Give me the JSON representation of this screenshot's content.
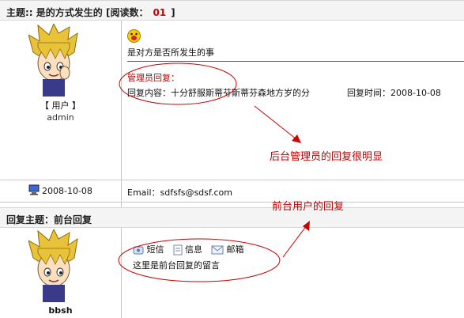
{
  "post1": {
    "title": "主题:: 是的方式发生的 [阅读数：",
    "read_count": "01",
    "title_end": "]",
    "role": "【 用户 】",
    "username": "admin",
    "body": "是对方是否所发生的事",
    "admin_reply_label": "管理员回复：",
    "reply_content": "回复内容：十分舒服斯蒂芬斯蒂芬森地方岁的分",
    "reply_time": "回复时间：2008-10-08",
    "date": "2008-10-08",
    "email": "Email：sdfsfs@sdsf.com"
  },
  "post2": {
    "title": "回复主题：前台回复",
    "buttons": [
      "短信",
      "信息",
      "邮箱"
    ],
    "body": "这里是前台回复的留言",
    "username": "bbsh"
  },
  "annotations": {
    "admin_note": "后台管理员的回复很明显",
    "front_note": "前台用户的回复"
  },
  "colors": {
    "annotation": "#cc0000",
    "header_bg": "#f4f4f4"
  }
}
